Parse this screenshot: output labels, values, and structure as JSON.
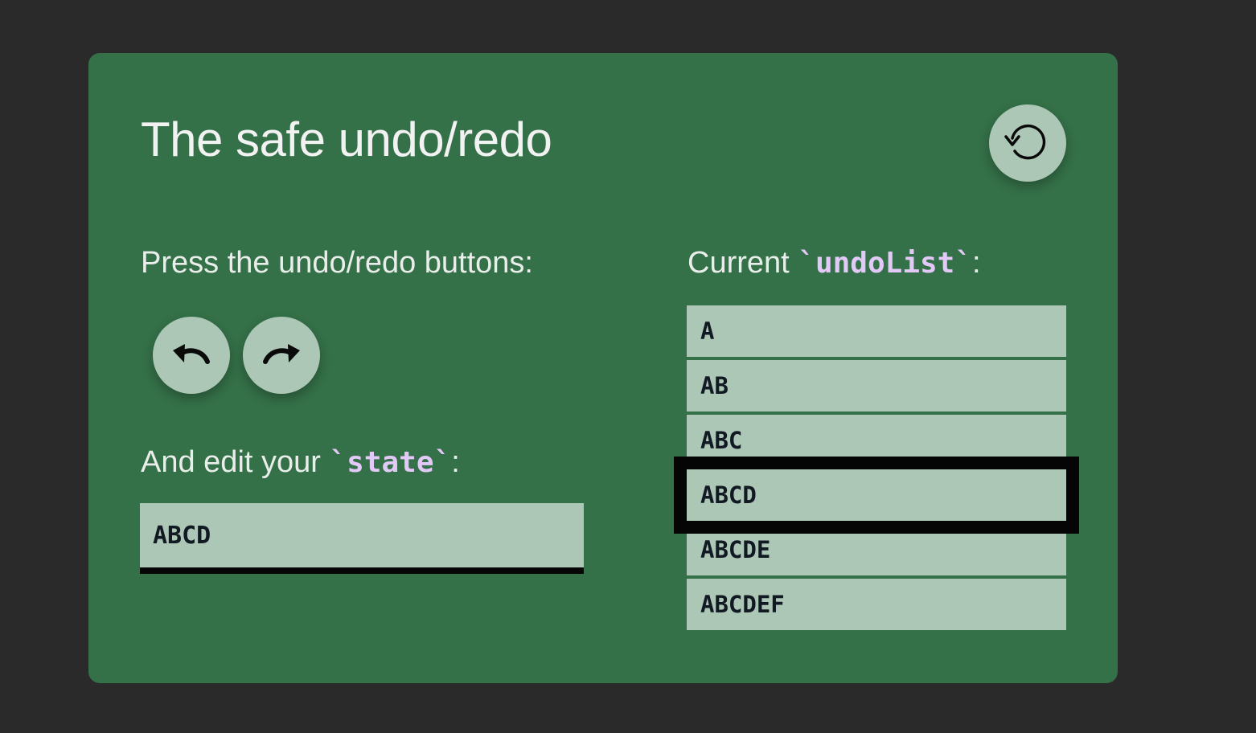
{
  "card": {
    "title": "The safe undo/redo"
  },
  "controls": {
    "reset_icon": "reset-icon",
    "undo_icon": "undo-icon",
    "redo_icon": "redo-icon",
    "press_label": "Press the undo/redo buttons:",
    "edit_label_prefix": "And edit your ",
    "edit_label_code": "`state`",
    "edit_label_suffix": ":"
  },
  "state_input": {
    "value": "ABCD"
  },
  "undo_list": {
    "label_prefix": "Current ",
    "label_code": "`undoList`",
    "label_suffix": ":",
    "items": [
      "A",
      "AB",
      "ABC",
      "ABCD",
      "ABCDE",
      "ABCDEF"
    ],
    "current_index": 3
  },
  "colors": {
    "background": "#2a2a2a",
    "card": "#347048",
    "button": "#adc7b6",
    "list_item": "#adc7b6",
    "code_text": "#e3c9f7",
    "highlight_border": "#050505"
  }
}
